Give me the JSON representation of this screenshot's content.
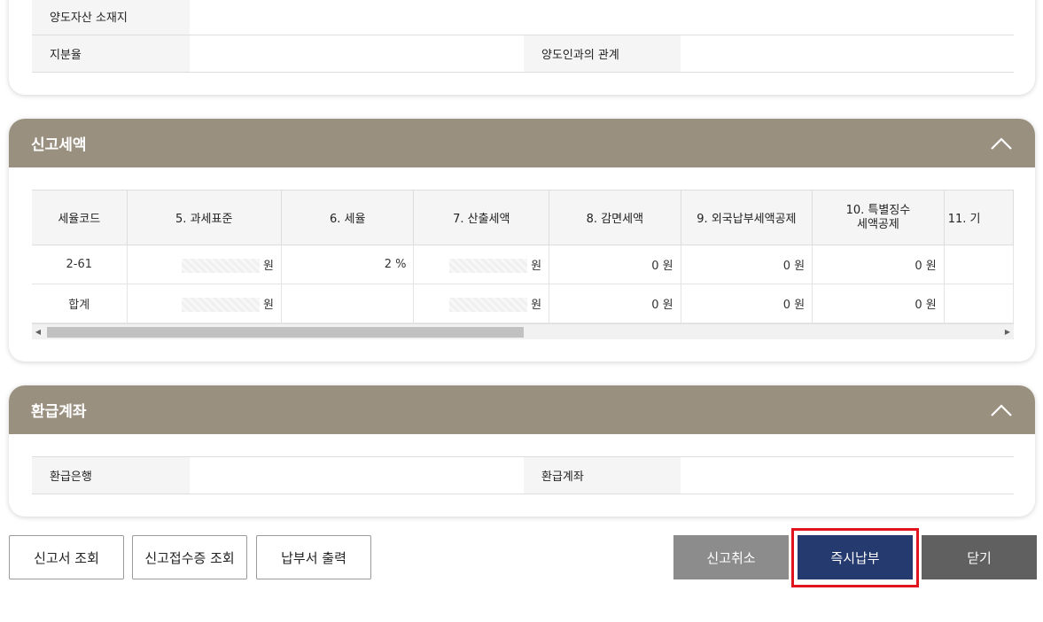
{
  "transfer_section": {
    "rows": [
      {
        "label": "양도자산 소재지",
        "value": ""
      },
      {
        "label": "지분율",
        "value": "",
        "label2": "양도인과의 관계",
        "value2": ""
      }
    ]
  },
  "tax_section": {
    "title": "신고세액",
    "collapse_icon": "chevron-up-icon",
    "columns": [
      "세율코드",
      "5. 과세표준",
      "6. 세율",
      "7. 산출세액",
      "8. 감면세액",
      "9. 외국납부세액공제",
      "10. 특별징수\n세액공제",
      "11. 기"
    ],
    "rows": [
      {
        "code": "2-61",
        "base_unit": "원",
        "rate": "2 %",
        "calc_unit": "원",
        "reduction": "0 원",
        "foreign": "0 원",
        "special": "0 원"
      },
      {
        "code": "합계",
        "base_unit": "원",
        "rate": "",
        "calc_unit": "원",
        "reduction": "0 원",
        "foreign": "0 원",
        "special": "0 원"
      }
    ],
    "scroll_position_fraction": 0.0
  },
  "refund_section": {
    "title": "환급계좌",
    "collapse_icon": "chevron-up-icon",
    "label1": "환급은행",
    "label2": "환급계좌"
  },
  "buttons": {
    "view_report": "신고서 조회",
    "view_receipt": "신고접수증 조회",
    "print_bill": "납부서 출력",
    "cancel_report": "신고취소",
    "pay_now": "즉시납부",
    "close": "닫기"
  },
  "colors": {
    "section_header": "#9a907f",
    "pay_button": "#253a6e",
    "cancel_button": "#8c8c8c",
    "close_button": "#606060",
    "highlight": "#e0141e"
  }
}
